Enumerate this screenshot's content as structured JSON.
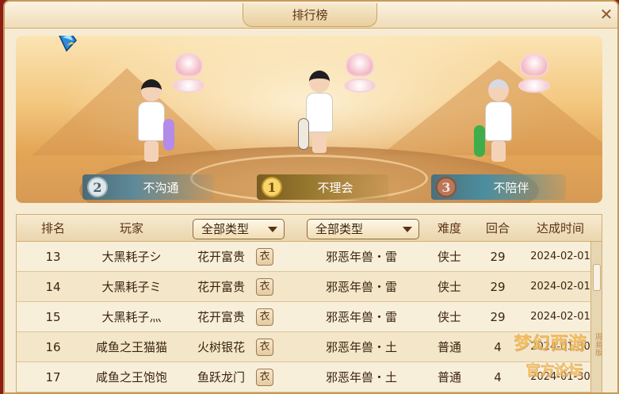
{
  "window": {
    "title": "排行榜",
    "close_glyph": "✕"
  },
  "podium": [
    {
      "rank_badge": "2",
      "name": "不沟通"
    },
    {
      "rank_badge": "1",
      "name": "不理会"
    },
    {
      "rank_badge": "3",
      "name": "不陪伴"
    }
  ],
  "table": {
    "headers": {
      "rank": "排名",
      "player": "玩家",
      "type_filter_1": "全部类型",
      "type_filter_2": "全部类型",
      "difficulty": "难度",
      "rounds": "回合",
      "time": "达成时间"
    },
    "rows": [
      {
        "rank": "13",
        "player": "大黑耗子シ",
        "item": "花开富贵",
        "monster": "邪恶年兽・雷",
        "difficulty": "侠士",
        "rounds": "29",
        "time": "2024-02-01"
      },
      {
        "rank": "14",
        "player": "大黑耗子ミ",
        "item": "花开富贵",
        "monster": "邪恶年兽・雷",
        "difficulty": "侠士",
        "rounds": "29",
        "time": "2024-02-01"
      },
      {
        "rank": "15",
        "player": "大黑耗子灬",
        "item": "花开富贵",
        "monster": "邪恶年兽・雷",
        "difficulty": "侠士",
        "rounds": "29",
        "time": "2024-02-01"
      },
      {
        "rank": "16",
        "player": "咸鱼之王猫猫",
        "item": "火树银花",
        "monster": "邪恶年兽・土",
        "difficulty": "普通",
        "rounds": "4",
        "time": "2024-01-30"
      },
      {
        "rank": "17",
        "player": "咸鱼之王饱饱",
        "item": "鱼跃龙门",
        "monster": "邪恶年兽・土",
        "difficulty": "普通",
        "rounds": "4",
        "time": "2024-01-30"
      }
    ]
  },
  "watermark": {
    "line1": "梦幻西游",
    "line2": "官方论坛",
    "side": "周易版"
  },
  "colors": {
    "title_text": "#5a3314",
    "table_text": "#3b2410",
    "gold": "#f6d56b"
  },
  "icons": {
    "close": "close-icon",
    "equipment": "armor-icon",
    "gem": "gem-icon"
  }
}
